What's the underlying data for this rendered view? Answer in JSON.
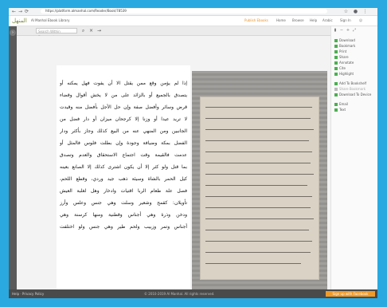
{
  "browser": {
    "url": "https://platform.almanhal.com/Reader/Book/78539",
    "back": "←",
    "forward": "→",
    "reload": "⟳"
  },
  "header": {
    "logo": "المنهل",
    "site_title": "Al Manhal Ebook Library",
    "cta": "Publish Ebooks",
    "nav": [
      "Home",
      "Browse",
      "Help",
      "Arabic",
      "Sign In"
    ]
  },
  "toolbar": {
    "search_placeholder": "Search Within Document",
    "search_icon": "search-icon",
    "close_icon": "close-icon",
    "arrow_icon": "arrow-right-icon"
  },
  "right_panel": {
    "items": [
      "Download",
      "Bookmark",
      "Print",
      "Share",
      "Annotate",
      "Cite",
      "Highlight",
      "Add To Bookshelf",
      "Share Bookmark",
      "Download To Device",
      "Email",
      "Text"
    ]
  },
  "page_text": [
    "إذا لم يؤمن وقع ممن يقتل الا أن يفوت فهل يمكنه أو",
    "يتصدق بالجميع أو بالزائد على من لا يخش أقوال وقضاء",
    "قرض وسائر وأفضل صفة وإن حل الأجل بأفضل منه وقيدت",
    "لا تريد عيدا أو وزنا إلا كرجحان ميزان أو دار فضل من",
    "الجانبين ومن المنهي عنه من البيع كذلك وجاز بأكثر ودار",
    "الفضل بمكة وضيافة وجودة وإن بطلت فلوس فالمثل أو",
    "عدمت فالقيمة وقت اجتماع الاستحقاق والعدم وتصدق",
    "بما قتل ولو كثر إلا أن يكون اشترى كذلك إلا الصانع بعينه",
    "كيل الحمر بالشاة وسيئة ذهب جيد وردي، وقطع اللحم،",
    "فصل علة طعام الربا اقتيات وادخار وهل لغلبة العيش",
    "تأويلان: كقمح وشعير وسلت وهي جنس وعلس وأرز",
    "ودخن وذرة وهي أجناس وقطنية ومنها كرسنة وهي",
    "أجناس وتمر وزبيب ولحم طير وهي جنس ولو اختلفت"
  ],
  "footer": {
    "left": "Help · Privacy Policy",
    "center": "© 2010-2019 Al Manhal. All rights reserved.",
    "button": "Sign up with Facebook"
  }
}
